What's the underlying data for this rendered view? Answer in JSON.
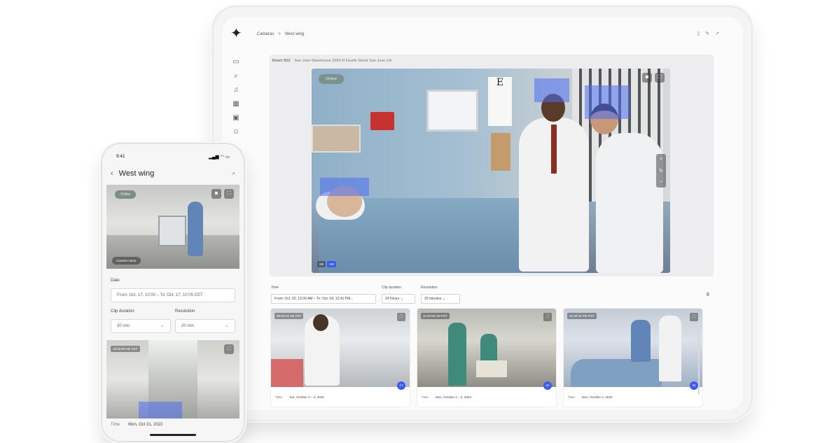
{
  "tablet": {
    "breadcrumb": {
      "root": "Cameras",
      "separator": ">",
      "current": "West wing"
    },
    "room": {
      "name": "Room 502",
      "address": "San Jose Warehouse 2090 N Fourth Street San Jose CA"
    },
    "video": {
      "status": "Online",
      "quality": [
        "SD",
        "HD"
      ],
      "eye_chart": "E"
    },
    "filters": {
      "time_label": "Time",
      "time_value": "From: Oct. 02, 12:00 AM – To: Oct. 04, 12:41 PM...",
      "clip_duration_label": "Clip duration",
      "clip_duration_value": "24 Hours",
      "resolution_label": "Resolution",
      "resolution_value": "20 minutes"
    },
    "clips": [
      {
        "timestamp": "09:00:13 AM PST",
        "time_label": "Time",
        "time_value": "Tue, October 3 – 4, 2023",
        "count": "17"
      },
      {
        "timestamp": "11:03:53 AM PST",
        "time_label": "Time",
        "time_value": "Mon, October 2 – 3, 2023",
        "count": "24"
      },
      {
        "timestamp": "02:30:34 PM PST",
        "time_label": "Time",
        "time_value": "Mon, October 2, 2023",
        "count": "26"
      }
    ]
  },
  "phone": {
    "status_time": "9:41",
    "status_icons": "▂▄▆ ◠ ▭",
    "title": "West wing",
    "video": {
      "status": "Online",
      "chip": "Camera name"
    },
    "date_label": "Date",
    "date_value": "From: Oct. 17, 10:00 – To: Oct. 17, 10:05 CET",
    "clip_duration_label": "Clip duration",
    "clip_duration_value": "30 min",
    "resolution_label": "Resolution",
    "resolution_value": "20 min",
    "clip_timestamp": "10:00:00 AM CET",
    "footer_time_label": "Time",
    "footer_time_value": "Mon, Oct 31, 2022"
  },
  "colors": {
    "accent": "#3d5af1",
    "detection": "#4f6ef0"
  },
  "icons": [
    "sparkle-logo-icon",
    "camera-icon",
    "search-icon",
    "bell-icon",
    "grid-icon",
    "calendar-icon",
    "settings-icon",
    "trash-icon",
    "edit-icon",
    "share-icon",
    "expand-icon",
    "snapshot-icon",
    "zoom-in-icon",
    "zoom-reset-icon",
    "zoom-out-icon",
    "filter-icon",
    "back-icon",
    "chevron-down-icon"
  ]
}
